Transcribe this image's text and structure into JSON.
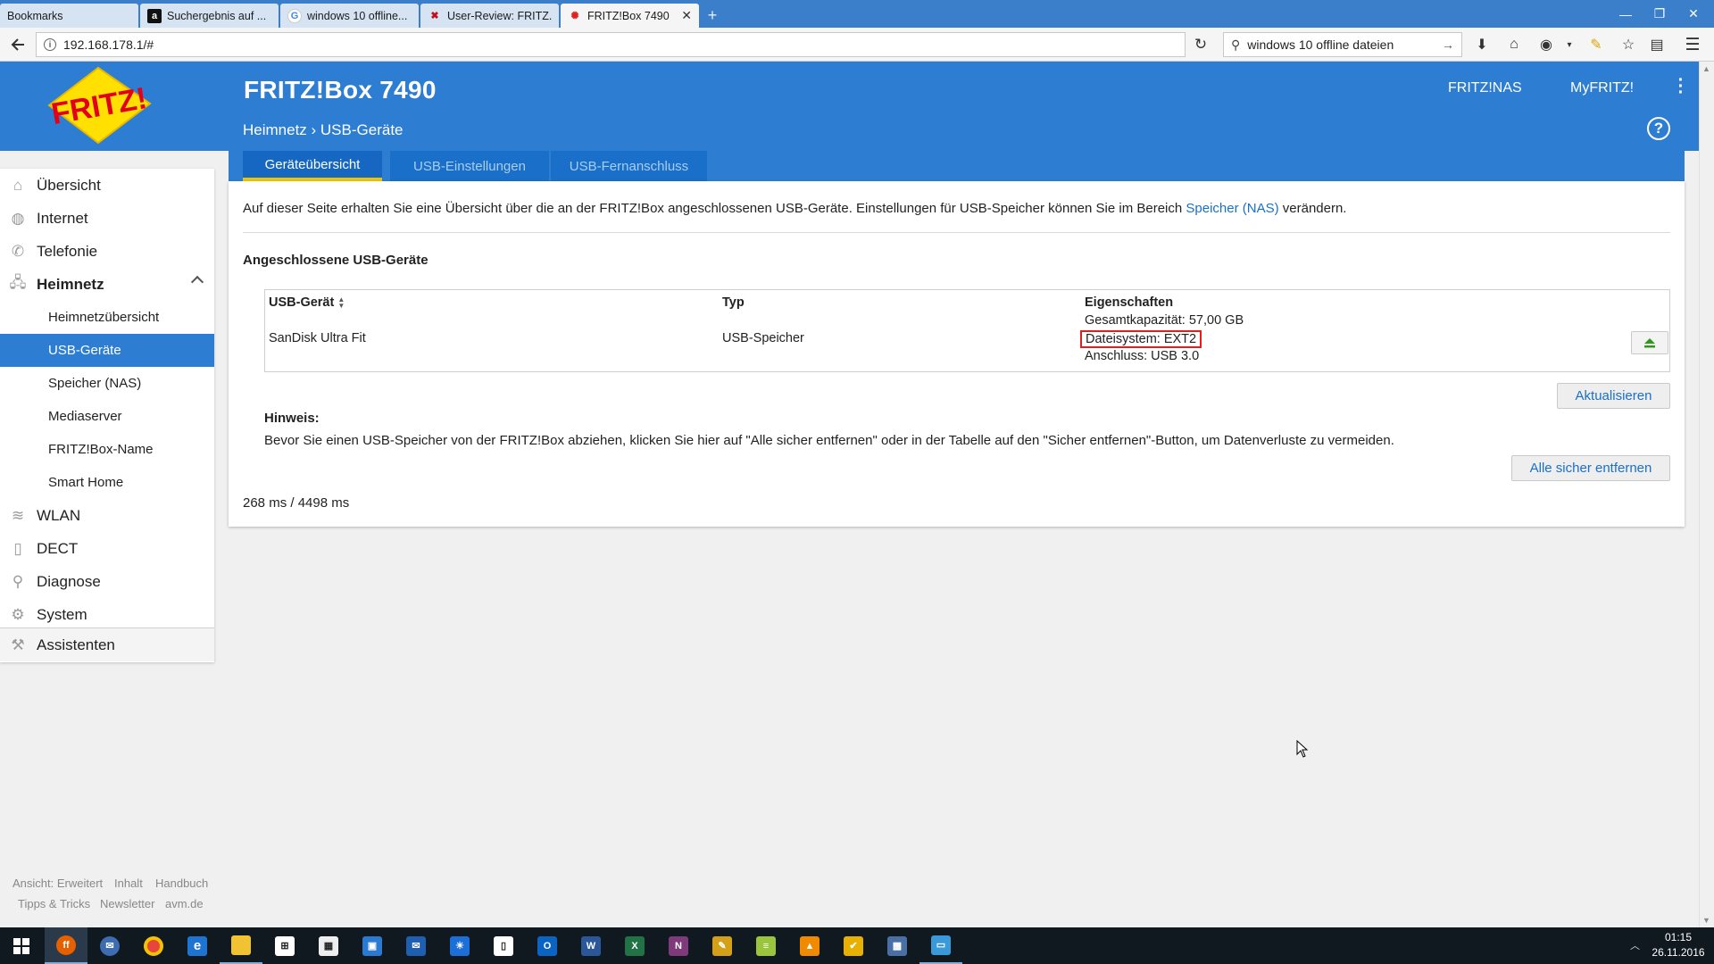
{
  "browser": {
    "tabs": [
      {
        "label": "Bookmarks",
        "icon": "bookmarks-icon"
      },
      {
        "label": "Suchergebnis auf ...",
        "icon": "amazon-icon"
      },
      {
        "label": "windows 10 offline...",
        "icon": "google-icon"
      },
      {
        "label": "User-Review: FRITZ...",
        "icon": "review-site-icon"
      },
      {
        "label": "FRITZ!Box 7490",
        "icon": "fritz-icon",
        "active": true
      }
    ],
    "url": "192.168.178.1/#",
    "search_value": "windows 10 offline dateien"
  },
  "fritz": {
    "logo_text": "FRITZ!",
    "title": "FRITZ!Box 7490",
    "header_links": [
      "FRITZ!NAS",
      "MyFRITZ!"
    ],
    "breadcrumb": "Heimnetz › USB-Geräte",
    "tabs": [
      "Geräteübersicht",
      "USB-Einstellungen",
      "USB-Fernanschluss"
    ],
    "intro_before_link": "Auf dieser Seite erhalten Sie eine Übersicht über die an der FRITZ!Box angeschlossenen USB-Geräte. Einstellungen für USB-Speicher können Sie im Bereich ",
    "intro_link": "Speicher (NAS)",
    "intro_after_link": " verändern.",
    "section_title": "Angeschlossene USB-Geräte",
    "table": {
      "headers": [
        "USB-Gerät",
        "Typ",
        "Eigenschaften"
      ],
      "rows": [
        {
          "device": "SanDisk Ultra Fit",
          "type": "USB-Speicher",
          "capacity": "Gesamtkapazität: 57,00 GB",
          "filesystem": "Dateisystem: EXT2",
          "connection": "Anschluss: USB 3.0"
        }
      ]
    },
    "refresh_button": "Aktualisieren",
    "note_title": "Hinweis:",
    "note_text": "Bevor Sie einen USB-Speicher von der FRITZ!Box abziehen, klicken Sie hier auf \"Alle sicher entfernen\" oder in der Tabelle auf den \"Sicher entfernen\"-Button, um Datenverluste zu vermeiden.",
    "remove_all_button": "Alle sicher entfernen",
    "timing": "268 ms / 4498 ms"
  },
  "sidebar": {
    "items": [
      {
        "label": "Übersicht",
        "icon": "home-icon"
      },
      {
        "label": "Internet",
        "icon": "globe-icon"
      },
      {
        "label": "Telefonie",
        "icon": "phone-icon"
      },
      {
        "label": "Heimnetz",
        "icon": "network-icon",
        "expanded": true
      },
      {
        "label": "WLAN",
        "icon": "wifi-icon"
      },
      {
        "label": "DECT",
        "icon": "dect-icon"
      },
      {
        "label": "Diagnose",
        "icon": "diagnose-icon"
      },
      {
        "label": "System",
        "icon": "system-icon"
      },
      {
        "label": "Assistenten",
        "icon": "wizard-icon"
      }
    ],
    "sub_items": [
      "Heimnetzübersicht",
      "USB-Geräte",
      "Speicher (NAS)",
      "Mediaserver",
      "FRITZ!Box-Name",
      "Smart Home"
    ],
    "active_sub": "USB-Geräte"
  },
  "footer": {
    "links_row1": [
      "Ansicht: Erweitert",
      "Inhalt",
      "Handbuch"
    ],
    "links_row2": [
      "Tipps & Tricks",
      "Newsletter",
      "avm.de"
    ]
  },
  "taskbar": {
    "time": "01:15",
    "date": "26.11.2016",
    "apps": [
      "start",
      "firefox",
      "thunderbird",
      "chrome",
      "edge",
      "explorer",
      "store",
      "calculator",
      "calendar",
      "mail",
      "weather",
      "notepad",
      "outlook",
      "word",
      "excel",
      "onenote",
      "tool",
      "notepadplus",
      "vlc",
      "tool2",
      "tool3",
      "screen"
    ]
  },
  "colors": {
    "fritz_blue": "#2d7ed3",
    "tab_active_underline": "#f0c400",
    "highlight_box": "#e0201c",
    "link": "#1a6fc9"
  }
}
